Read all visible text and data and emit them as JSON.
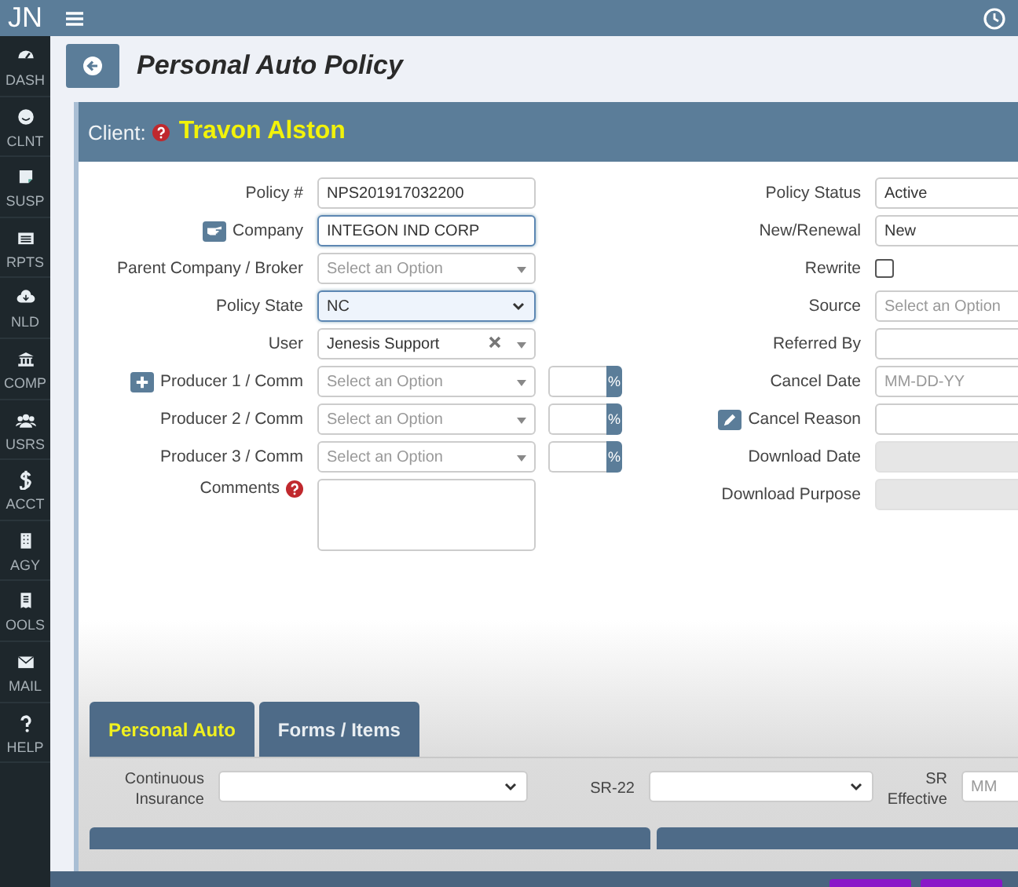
{
  "brand": "JN",
  "sidebar": {
    "items": [
      {
        "label": "DASH",
        "selected": false
      },
      {
        "label": "CLNT",
        "selected": false
      },
      {
        "label": "SUSP",
        "selected": false
      },
      {
        "label": "RPTS",
        "selected": false
      },
      {
        "label": "NLD",
        "selected": false
      },
      {
        "label": "COMP",
        "selected": false
      },
      {
        "label": "USRS",
        "selected": false
      },
      {
        "label": "ACCT",
        "selected": false
      },
      {
        "label": "AGY",
        "selected": false
      },
      {
        "label": "OOLS",
        "selected": false
      },
      {
        "label": "MAIL",
        "selected": false
      },
      {
        "label": "HELP",
        "selected": false
      }
    ]
  },
  "page": {
    "title": "Personal Auto Policy"
  },
  "client": {
    "label": "Client:",
    "name": "Travon Alston"
  },
  "left_fields": [
    {
      "label": "Policy #",
      "kind": "text",
      "value": "NPS201917032200"
    },
    {
      "label": "Company",
      "kind": "text",
      "value": "INTEGON IND CORP",
      "focused": true,
      "label_icon": {
        "kind": "hand"
      }
    },
    {
      "label": "Parent Company / Broker",
      "kind": "select",
      "placeholder": "Select an Option"
    },
    {
      "label": "Policy State",
      "kind": "dropdown",
      "value": "NC",
      "focused": true
    },
    {
      "label": "User",
      "kind": "select",
      "value": "Jenesis Support",
      "clearable": true
    },
    {
      "label": "Producer 1 / Comm",
      "kind": "producer",
      "placeholder": "Select an Option",
      "percent": "%",
      "label_icon": {
        "kind": "plus"
      }
    },
    {
      "label": "Producer 2 / Comm",
      "kind": "producer",
      "placeholder": "Select an Option",
      "percent": "%"
    },
    {
      "label": "Producer 3 / Comm",
      "kind": "producer",
      "placeholder": "Select an Option",
      "percent": "%"
    },
    {
      "label": "Comments",
      "kind": "textarea",
      "label_icon": {
        "kind": "help"
      }
    }
  ],
  "right_fields": [
    {
      "label": "Policy Status",
      "kind": "text",
      "value": "Active"
    },
    {
      "label": "New/Renewal",
      "kind": "text",
      "value": "New"
    },
    {
      "label": "Rewrite",
      "kind": "checkbox",
      "checked": false
    },
    {
      "label": "Source",
      "kind": "text",
      "placeholder": "Select an Option"
    },
    {
      "label": "Referred By",
      "kind": "text"
    },
    {
      "label": "Cancel Date",
      "kind": "text",
      "placeholder": "MM-DD-YY"
    },
    {
      "label": "Cancel Reason",
      "kind": "text",
      "label_icon": {
        "kind": "edit"
      }
    },
    {
      "label": "Download Date",
      "kind": "text",
      "disabled": true
    },
    {
      "label": "Download Purpose",
      "kind": "text",
      "disabled": true
    }
  ],
  "tabs": [
    {
      "label": "Personal Auto",
      "selected": true
    },
    {
      "label": "Forms / Items",
      "selected": false
    }
  ],
  "auto_fields": [
    {
      "label": "Continuous Insurance",
      "kind": "dropdown"
    },
    {
      "label": "SR-22",
      "kind": "dropdown"
    },
    {
      "label": "SR Effective",
      "kind": "text",
      "placeholder": "MM"
    }
  ]
}
